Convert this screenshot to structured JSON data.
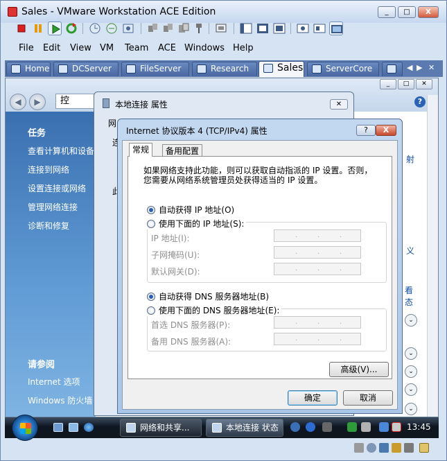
{
  "window": {
    "title": "Sales - VMware Workstation ACE Edition",
    "min": "_",
    "max": "□",
    "close": "X"
  },
  "menu": [
    "File",
    "Edit",
    "View",
    "VM",
    "Team",
    "ACE",
    "Windows",
    "Help"
  ],
  "tabs": [
    {
      "label": "Home",
      "active": false
    },
    {
      "label": "DCServer",
      "active": false
    },
    {
      "label": "FileServer",
      "active": false
    },
    {
      "label": "Research",
      "active": false
    },
    {
      "label": "Sales",
      "active": true
    },
    {
      "label": "ServerCore",
      "active": false
    }
  ],
  "tab_nav": {
    "prev": "◀",
    "next": "▶",
    "close": "✕"
  },
  "guest": {
    "address_crumb": "控",
    "sidebar": {
      "tasks_heading": "任务",
      "tasks": [
        "查看计算机和设备",
        "连接到网络",
        "设置连接或网络",
        "管理网络连接",
        "诊断和修复"
      ],
      "see_also_heading": "请参阅",
      "see_also": [
        "Internet 选项",
        "Windows 防火墙"
      ]
    },
    "right_fragments": [
      "射",
      "义",
      "看",
      "态"
    ]
  },
  "dialog_lan": {
    "title": "本地连接 属性",
    "close": "✕",
    "tab_fragment": "网",
    "frag1": "连",
    "frag2": "此"
  },
  "dialog_ipv4": {
    "title": "Internet 协议版本 4 (TCP/IPv4) 属性",
    "help": "?",
    "close": "X",
    "tabs": [
      "常规",
      "备用配置"
    ],
    "description_line1": "如果网络支持此功能，则可以获取自动指派的 IP 设置。否则，",
    "description_line2": "您需要从网络系统管理员处获得适当的 IP 设置。",
    "auto_ip": "自动获得 IP 地址(O)",
    "manual_ip": "使用下面的 IP 地址(S):",
    "ip_address_label": "IP 地址(I):",
    "subnet_label": "子网掩码(U):",
    "gateway_label": "默认网关(D):",
    "auto_dns": "自动获得 DNS 服务器地址(B)",
    "manual_dns": "使用下面的 DNS 服务器地址(E):",
    "preferred_dns_label": "首选 DNS 服务器(P):",
    "alternate_dns_label": "备用 DNS 服务器(A):",
    "ip_dots": ".",
    "advanced": "高级(V)...",
    "ok": "确定",
    "cancel": "取消"
  },
  "taskbar": {
    "buttons": [
      "网络和共享...",
      "本地连接 状态"
    ],
    "clock": "13:45"
  }
}
